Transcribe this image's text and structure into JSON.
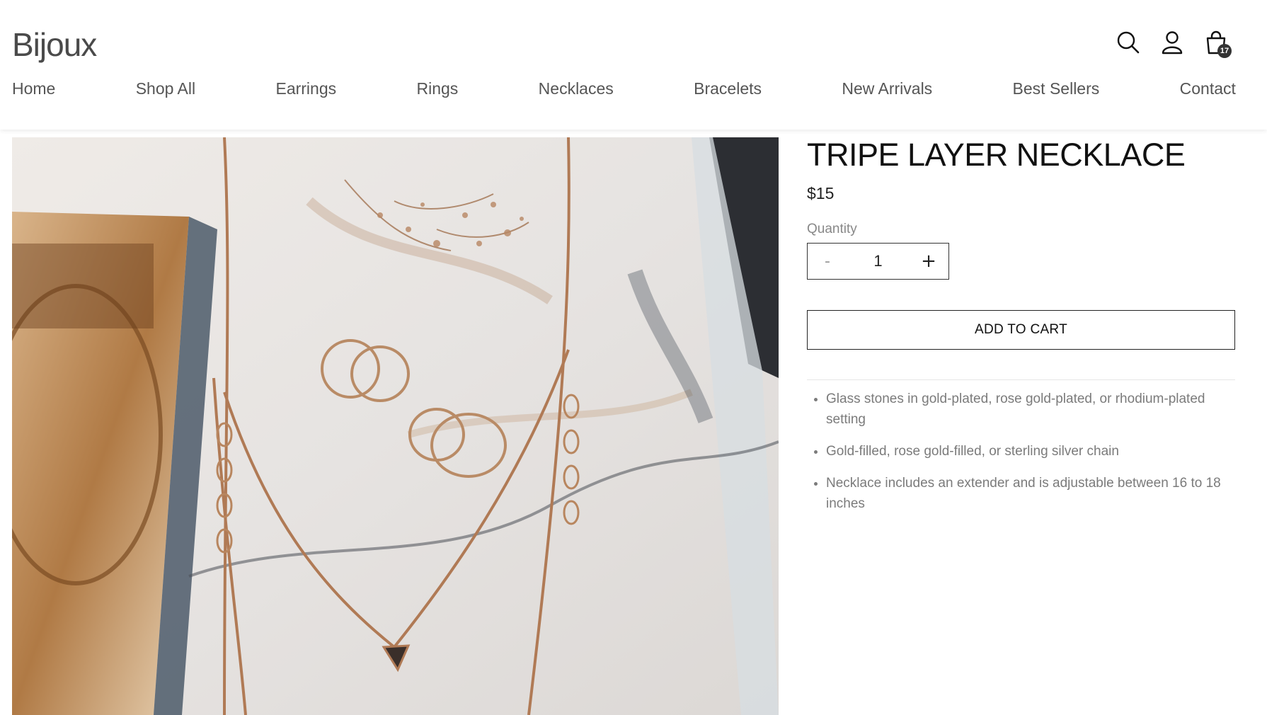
{
  "header": {
    "logo": "Bijoux",
    "cart_count": "17",
    "icons": [
      "search-icon",
      "account-icon",
      "shopping-bag-icon"
    ]
  },
  "nav": {
    "items": [
      "Home",
      "Shop All",
      "Earrings",
      "Rings",
      "Necklaces",
      "Bracelets",
      "New Arrivals",
      "Best Sellers",
      "Contact"
    ]
  },
  "product": {
    "title": "TRIPE LAYER NECKLACE",
    "price": "$15",
    "quantity_label": "Quantity",
    "quantity_value": "1",
    "decrement_label": "-",
    "increment_label": "+",
    "add_to_cart_label": "ADD TO CART",
    "features": [
      "Glass stones in gold-plated, rose gold-plated, or rhodium-plated setting",
      "Gold-filled, rose gold-filled, or sterling silver chain",
      "Necklace includes an extender and is adjustable between 16 to 18 inches"
    ]
  },
  "colors": {
    "text_dark": "#111111",
    "text_muted": "#7b7b7b",
    "border": "#222222"
  }
}
